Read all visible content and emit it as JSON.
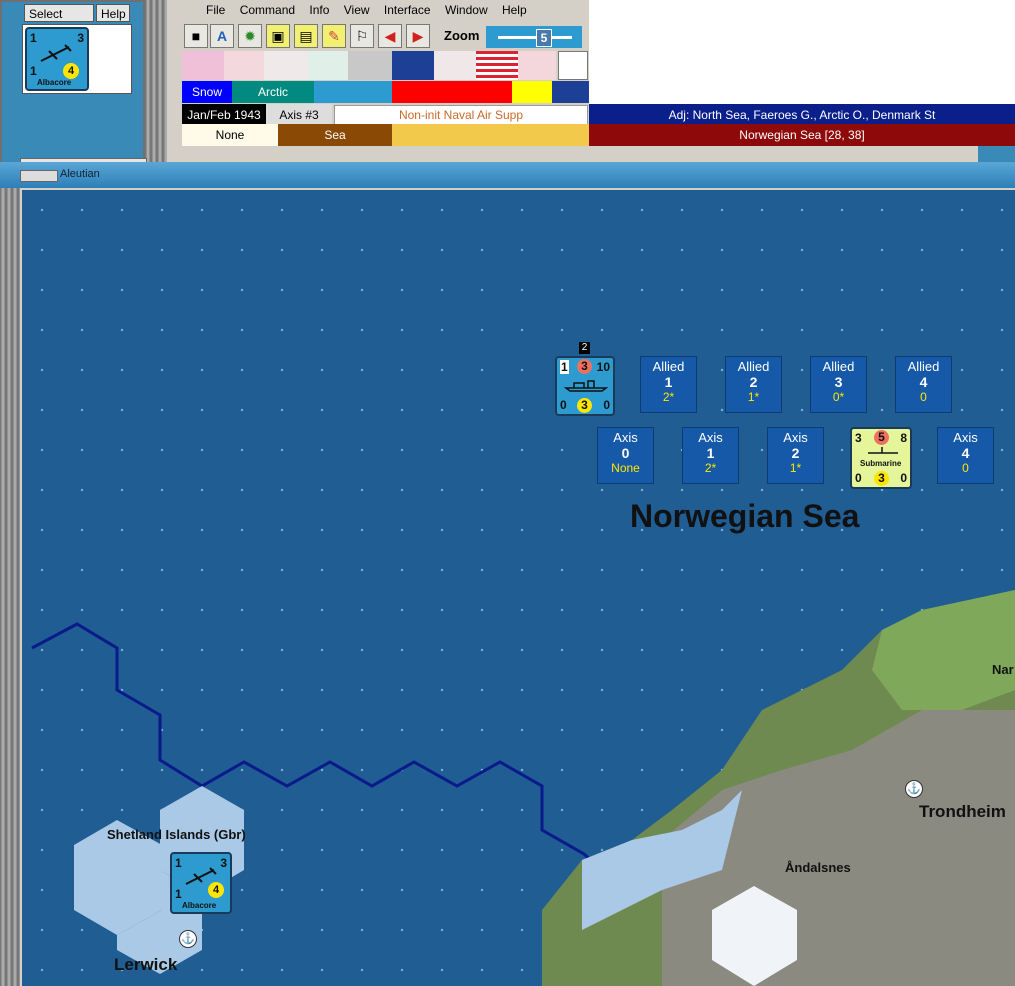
{
  "select_panel": {
    "select_label": "Select",
    "help_label": "Help",
    "selected_unit": {
      "name": "Albacore",
      "top_left": "1",
      "top_right": "3",
      "bottom_left": "1",
      "center_value": "4"
    }
  },
  "menu": {
    "items": [
      "File",
      "Command",
      "Info",
      "View",
      "Interface",
      "Window",
      "Help"
    ]
  },
  "toolbar": {
    "zoom_label": "Zoom",
    "zoom_value": "5"
  },
  "info_rows": {
    "weather": "Snow",
    "climate": "Arctic",
    "date": "Jan/Feb 1943",
    "side_impulse": "Axis #3",
    "mode": "Non-init Naval Air Supp",
    "adjacent": "Adj: North Sea, Faeroes G., Arctic O., Denmark St",
    "control": "None",
    "terrain": "Sea",
    "location": "Norwegian Sea [28, 38]"
  },
  "tab_label": "Aleutian",
  "map": {
    "sea_zone_name": "Norwegian Sea",
    "allied_boxes": [
      {
        "label": "Allied",
        "number": "1",
        "value": "2*"
      },
      {
        "label": "Allied",
        "number": "2",
        "value": "1*"
      },
      {
        "label": "Allied",
        "number": "3",
        "value": "0*"
      },
      {
        "label": "Allied",
        "number": "4",
        "value": "0"
      }
    ],
    "axis_boxes": [
      {
        "label": "Axis",
        "number": "0",
        "value": "None"
      },
      {
        "label": "Axis",
        "number": "1",
        "value": "2*"
      },
      {
        "label": "Axis",
        "number": "2",
        "value": "1*"
      },
      {
        "label": "Axis",
        "number": "4",
        "value": "0"
      }
    ],
    "ship_counter": {
      "top_left": "1",
      "top_mid": "3",
      "top_right": "10",
      "bottom_left": "0",
      "bottom_mid": "3",
      "bottom_right": "0",
      "stack": "2"
    },
    "sub_counter": {
      "name": "Submarine",
      "top_left": "3",
      "top_mid": "5",
      "top_right": "8",
      "bottom_left": "0",
      "bottom_mid": "3",
      "bottom_right": "0"
    },
    "air_counter": {
      "name": "Albacore",
      "top_left": "1",
      "top_right": "3",
      "bottom_left": "1",
      "center_value": "4"
    },
    "place_labels": {
      "shetland": "Shetland Islands (Gbr)",
      "lerwick": "Lerwick",
      "andalsnes": "Åndalsnes",
      "trondheim": "Trondheim",
      "narvik_partial": "Nar"
    }
  },
  "colors": {
    "sea": "#1f5d93",
    "allied_box": "#1559a8",
    "adjacent_bar": "#0b1f8a",
    "location_bar": "#8e0a0a",
    "terrain_sea": "#8a4a06",
    "counter_blue": "#2e9bd0",
    "sub_yellow": "#e4f59a"
  }
}
